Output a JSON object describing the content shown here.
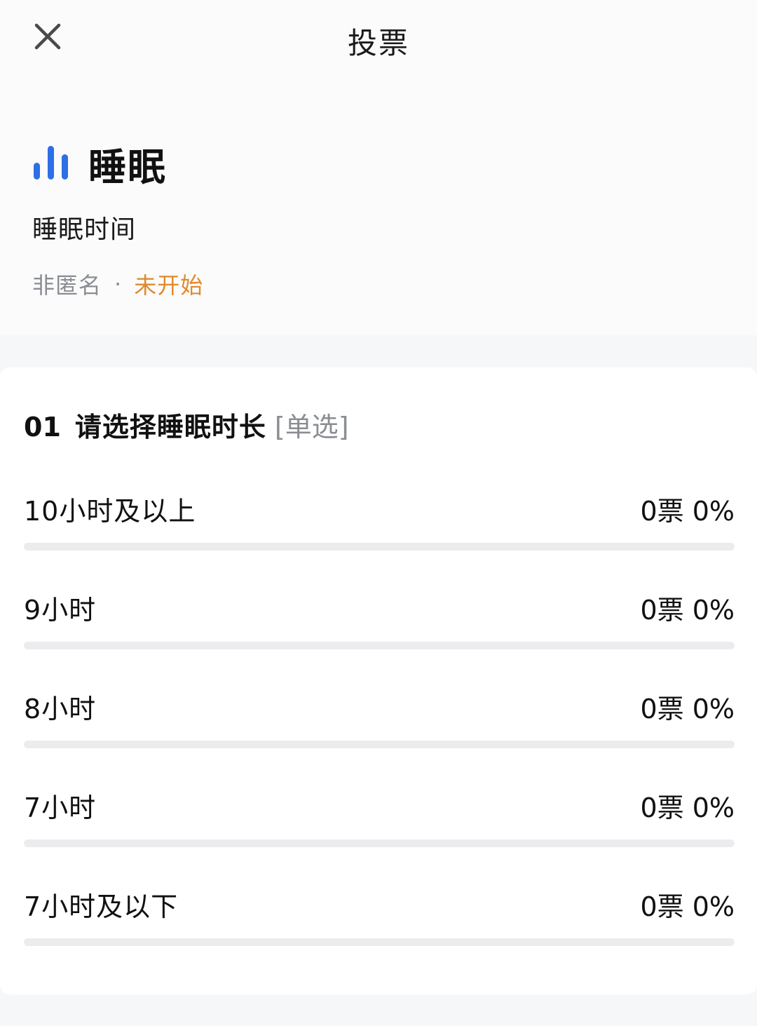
{
  "header": {
    "title": "投票",
    "close_icon": "close-icon"
  },
  "poll": {
    "title": "睡眠",
    "icon": "bar-chart-icon",
    "icon_color": "#2e6fe6",
    "description": "睡眠时间",
    "anonymity": "非匿名",
    "separator": "·",
    "status": "未开始",
    "status_color": "#e08a2e"
  },
  "question": {
    "number": "01",
    "text": "请选择睡眠时长",
    "type": "[单选]",
    "options": [
      {
        "label": "10小时及以上",
        "stats": "0票 0%",
        "percent": 0
      },
      {
        "label": "9小时",
        "stats": "0票 0%",
        "percent": 0
      },
      {
        "label": "8小时",
        "stats": "0票 0%",
        "percent": 0
      },
      {
        "label": "7小时",
        "stats": "0票 0%",
        "percent": 0
      },
      {
        "label": "7小时及以下",
        "stats": "0票 0%",
        "percent": 0
      }
    ]
  }
}
